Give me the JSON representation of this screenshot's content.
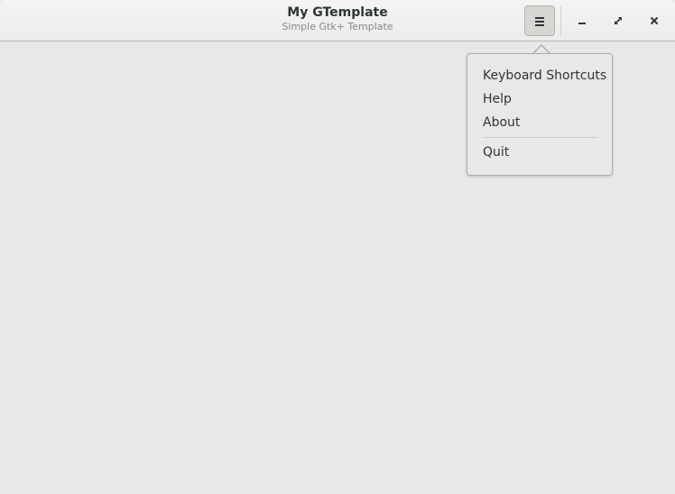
{
  "window": {
    "title": "My GTemplate",
    "subtitle": "Simple Gtk+ Template"
  },
  "header": {
    "menu_button_icon": "hamburger-menu-icon",
    "window_controls": [
      {
        "name": "minimize",
        "icon": "minimize-icon"
      },
      {
        "name": "maximize",
        "icon": "maximize-icon"
      },
      {
        "name": "close",
        "icon": "close-icon"
      }
    ]
  },
  "app_menu": {
    "items": [
      {
        "label": "Keyboard Shortcuts"
      },
      {
        "label": "Help"
      },
      {
        "label": "About"
      },
      {
        "label": "Quit"
      }
    ]
  },
  "colors": {
    "background": "#e8e8e7",
    "headerbar": "#f4f4f3",
    "text": "#2e3436",
    "subtitle": "#888a85"
  }
}
